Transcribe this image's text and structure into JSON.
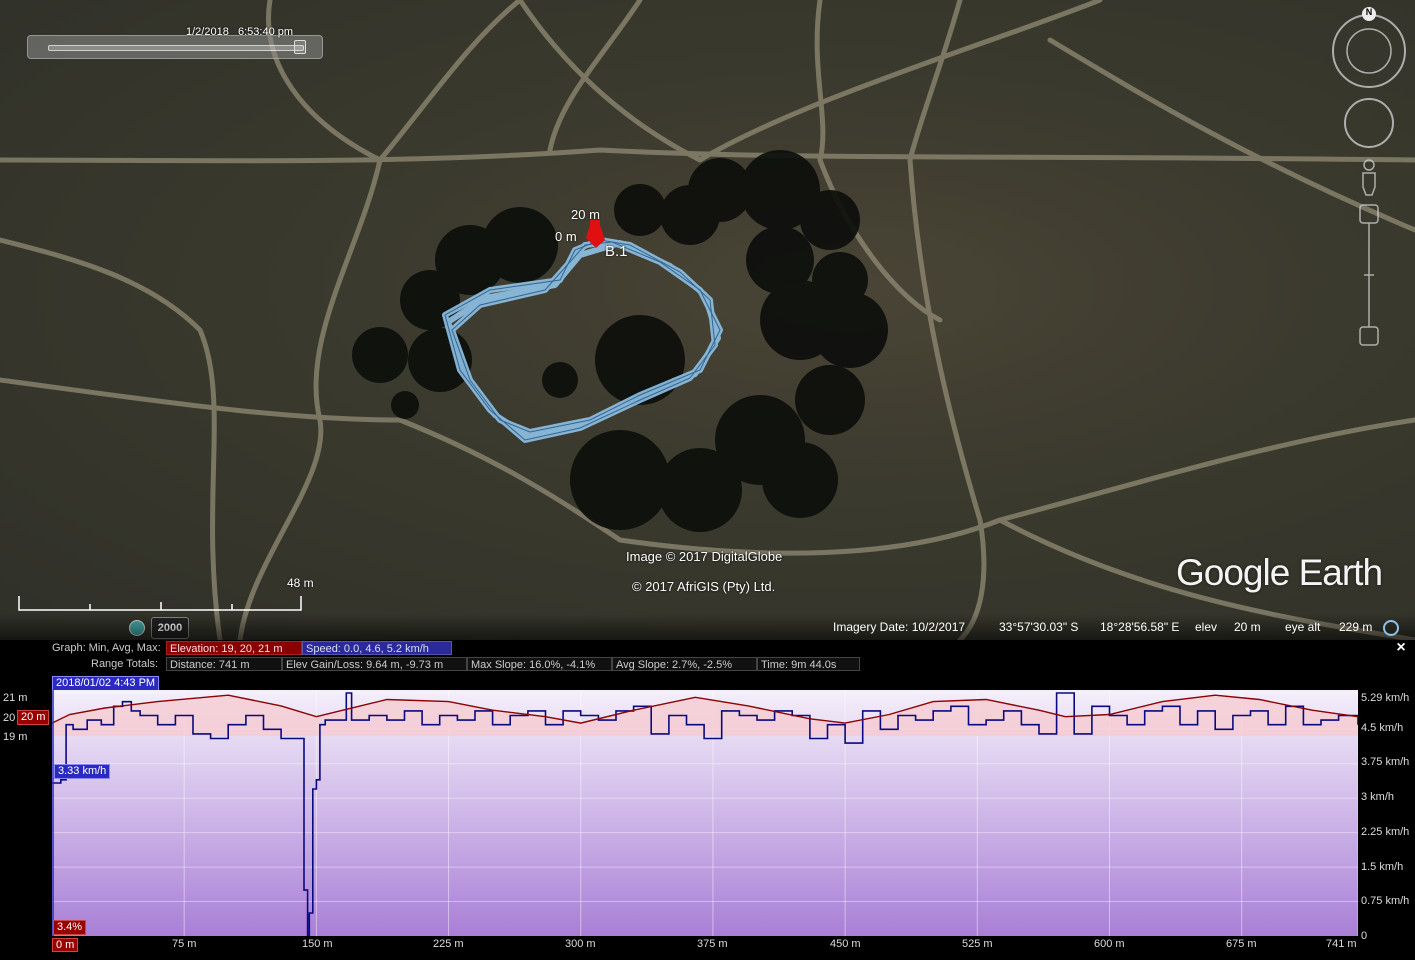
{
  "map": {
    "time_label": "1/2/2018   6:53:40 pm",
    "track_label_start": "0 m",
    "track_label_top": "20 m",
    "placemark_label": "B.1",
    "image_credit": "Image © 2017 DigitalGlobe",
    "data_credit": "© 2017 AfriGIS (Pty) Ltd.",
    "brand": "Google Earth",
    "scale_label": "48 m",
    "year_badge": "2000",
    "compass_north": "N"
  },
  "status": {
    "imagery_date": "Imagery Date: 10/2/2017",
    "latitude": "33°57'30.03\" S",
    "longitude": "18°28'56.58\" E",
    "elev_label": "elev",
    "elev_value": "20 m",
    "eye_alt_label": "eye alt",
    "eye_alt_value": "229 m"
  },
  "graph": {
    "row1_label": "Graph: Min, Avg, Max:",
    "elevation_stat": "Elevation: 19, 20, 21 m",
    "speed_stat": "Speed: 0.0, 4.6, 5.2 km/h",
    "row2_label": "Range Totals:",
    "distance": "Distance: 741 m",
    "elev_gain_loss": "Elev Gain/Loss: 9.64 m, -9.73 m",
    "max_slope": "Max Slope: 16.0%, -4.1%",
    "avg_slope": "Avg Slope: 2.7%, -2.5%",
    "time": "Time: 9m 44.0s",
    "date_tag": "2018/01/02 4:43 PM",
    "speed_tag": "3.33 km/h",
    "elev_tag": "20 m",
    "slope_tag": "3.4%",
    "start_tag": "0 m",
    "close": "×"
  },
  "chart_data": {
    "type": "line",
    "xlabel": "",
    "x_ticks": [
      "0 m",
      "75 m",
      "150 m",
      "225 m",
      "300 m",
      "375 m",
      "450 m",
      "525 m",
      "600 m",
      "675 m",
      "741 m"
    ],
    "x_range": [
      0,
      741
    ],
    "left_axis": {
      "ticks": [
        "21 m",
        "20 m",
        "19 m"
      ],
      "range": [
        19,
        21
      ]
    },
    "right_axis": {
      "ticks": [
        "5.29 km/h",
        "4.5 km/h",
        "3.75 km/h",
        "3 km/h",
        "2.25 km/h",
        "1.5 km/h",
        "0.75 km/h",
        "0"
      ],
      "range": [
        0,
        5.29
      ]
    },
    "series": [
      {
        "name": "Elevation",
        "color": "#8b0000",
        "x": [
          0,
          10,
          30,
          60,
          100,
          130,
          150,
          165,
          190,
          225,
          250,
          280,
          300,
          330,
          365,
          395,
          430,
          450,
          475,
          500,
          530,
          560,
          575,
          600,
          630,
          660,
          685,
          715,
          741
        ],
        "values": [
          19.6,
          20.0,
          20.3,
          20.6,
          20.9,
          20.4,
          19.9,
          20.2,
          20.7,
          20.6,
          20.2,
          19.9,
          19.6,
          20.2,
          20.8,
          20.4,
          19.8,
          19.6,
          20.0,
          20.6,
          20.7,
          20.2,
          19.9,
          20.0,
          20.6,
          20.9,
          20.7,
          20.2,
          19.9
        ]
      },
      {
        "name": "Speed",
        "color": "#0a0a80",
        "x": [
          0,
          5,
          8,
          12,
          20,
          28,
          35,
          40,
          45,
          50,
          60,
          70,
          80,
          90,
          100,
          110,
          120,
          130,
          140,
          143,
          145,
          146,
          148,
          150,
          152,
          155,
          160,
          167,
          170,
          180,
          190,
          200,
          210,
          220,
          230,
          240,
          250,
          260,
          270,
          280,
          290,
          300,
          310,
          320,
          330,
          340,
          350,
          360,
          370,
          380,
          390,
          400,
          410,
          420,
          430,
          440,
          450,
          460,
          470,
          480,
          490,
          500,
          510,
          520,
          530,
          540,
          550,
          560,
          570,
          580,
          590,
          600,
          610,
          620,
          630,
          640,
          650,
          660,
          670,
          680,
          690,
          700,
          710,
          720,
          730,
          741
        ],
        "values": [
          3.33,
          3.4,
          4.6,
          4.5,
          4.7,
          4.6,
          5.0,
          5.1,
          4.9,
          4.8,
          4.6,
          4.8,
          4.4,
          4.3,
          4.6,
          4.8,
          4.5,
          4.3,
          4.3,
          1.0,
          0.0,
          0.5,
          3.2,
          3.4,
          4.6,
          4.7,
          4.7,
          5.29,
          4.7,
          4.8,
          4.7,
          4.9,
          4.6,
          4.8,
          4.7,
          4.9,
          4.6,
          4.8,
          4.9,
          4.6,
          4.9,
          4.8,
          4.7,
          4.9,
          5.0,
          4.4,
          4.8,
          4.6,
          4.3,
          4.9,
          4.8,
          4.7,
          4.9,
          4.8,
          4.3,
          4.6,
          4.2,
          4.9,
          4.5,
          4.8,
          4.7,
          4.9,
          5.0,
          4.6,
          4.7,
          4.9,
          4.6,
          4.4,
          5.29,
          4.4,
          5.0,
          4.8,
          4.6,
          4.9,
          5.0,
          4.6,
          4.9,
          4.5,
          4.8,
          4.9,
          4.6,
          5.0,
          4.6,
          4.7,
          4.8,
          4.6
        ]
      }
    ]
  }
}
